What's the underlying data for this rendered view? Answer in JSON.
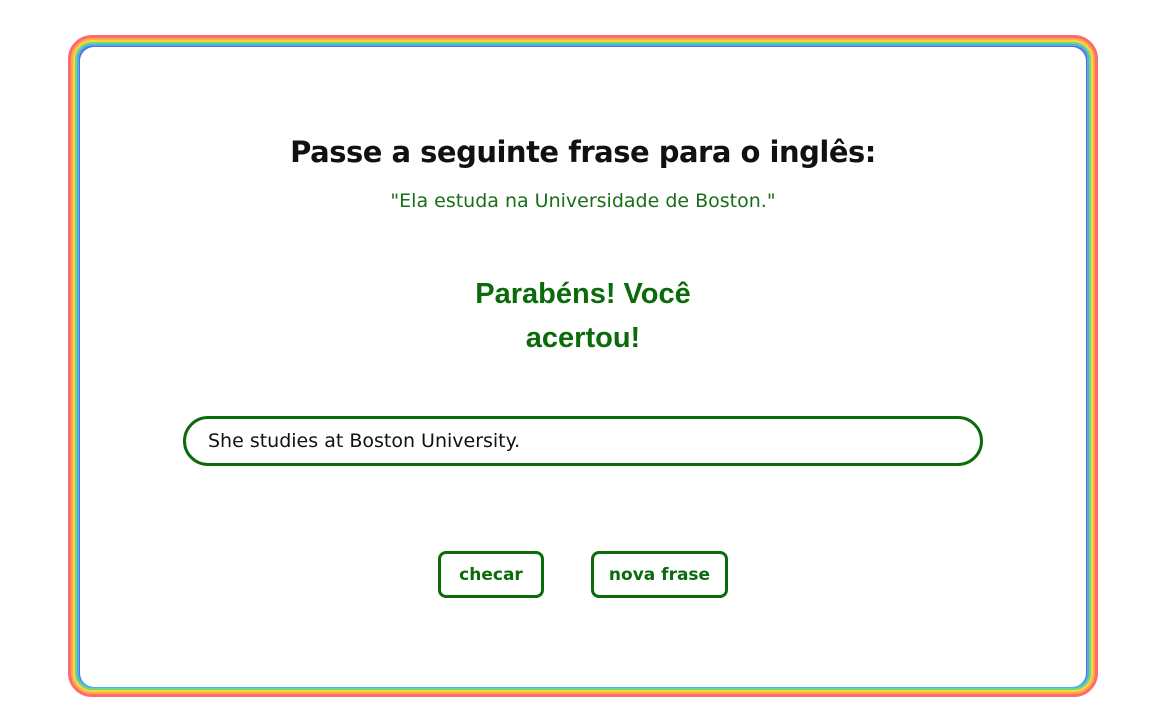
{
  "prompt": {
    "title": "Passe a seguinte frase para o inglês:",
    "phrase": "\"Ela estuda na Universidade de Boston.\""
  },
  "feedback": {
    "message": "Parabéns! Você acertou!"
  },
  "answer": {
    "value": "She studies at Boston University."
  },
  "buttons": {
    "check_label": "checar",
    "new_phrase_label": "nova frase"
  },
  "colors": {
    "accent_green": "#0b6b0b",
    "phrase_green": "#1a6e1a",
    "frame_outer": "#ff6b6b",
    "frame_inner": "#5c6bd6"
  }
}
